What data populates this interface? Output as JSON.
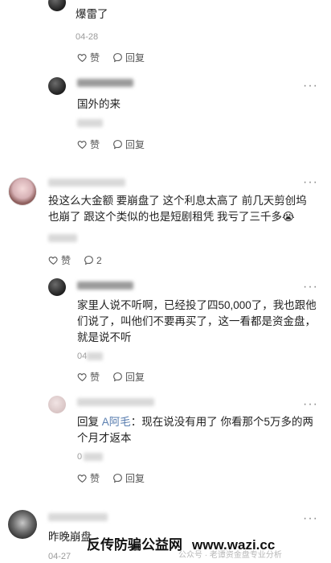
{
  "c1": {
    "text": "爆雷了",
    "time": "04-28",
    "like": "赞",
    "reply": "回复"
  },
  "c2": {
    "text": "国外的来",
    "like": "赞",
    "reply": "回复",
    "more": "···"
  },
  "c3": {
    "text": "投这么大金额 要崩盘了 这个利息太高了 前几天剪创坞也崩了 跟这个类似的也是短剧租凭 我亏了三千多😭",
    "like": "赞",
    "reply": "2",
    "more": "···"
  },
  "c4": {
    "text": "家里人说不听啊，已经投了四50,000了，我也跟他们说了，叫他们不要再买了，这一看都是资金盘，就是说不听",
    "time_part": "04",
    "like": "赞",
    "reply": "回复",
    "more": "···"
  },
  "c5": {
    "reply_prefix": "回复 ",
    "reply_to": "A阿毛",
    "text": "：现在说没有用了 你看那个5万多的两个月才返本",
    "time_part": "0",
    "like": "赞",
    "reply": "回复",
    "more": "···"
  },
  "c6": {
    "text_part": "昨晚崩盘",
    "time": "04-27",
    "more": "···"
  },
  "watermark": {
    "main": "反传防骗公益网",
    "site": "www.wazi.cc"
  },
  "gzh": "公众号 · 老谭资金盘专业分析"
}
